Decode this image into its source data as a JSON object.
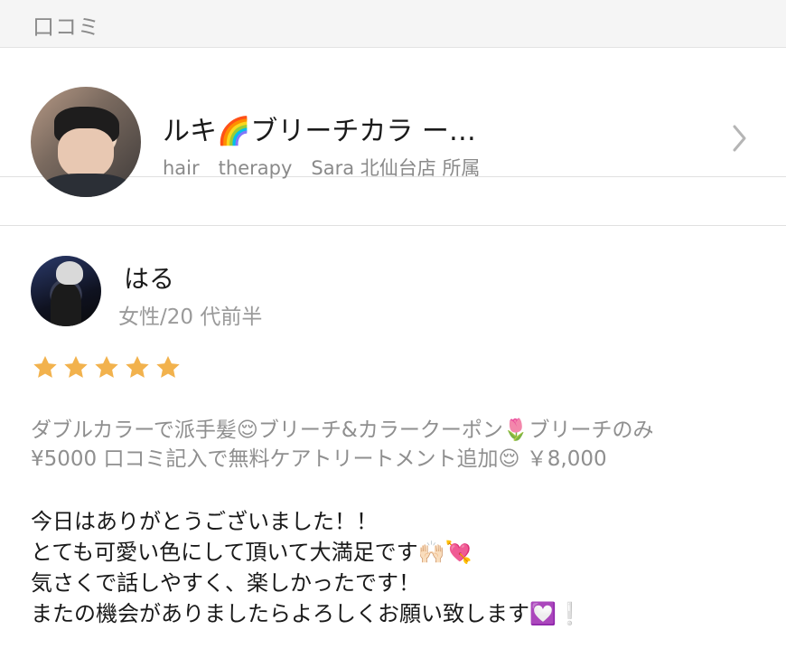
{
  "section": {
    "title": "口コミ"
  },
  "stylist": {
    "name": "ルキ🌈ブリーチカラ ー…",
    "salon": "hair　therapy　Sara 北仙台店 所属"
  },
  "reviewer": {
    "name": "はる",
    "meta": "女性/20 代前半"
  },
  "rating": {
    "stars": 5,
    "star_color": "#f2b24d"
  },
  "coupon": {
    "line1": "ダブルカラーで派手髪😌ブリーチ&カラークーポン🌷ブリーチのみ",
    "line2": "¥5000  口コミ記入で無料ケアトリートメント追加😌 ￥8,000"
  },
  "review": {
    "line1": "今日はありがとうございました！！",
    "line2": "とても可愛い色にして頂いて大満足です🙌🏻💘",
    "line3": "気さくで話しやすく、楽しかったです！",
    "line4": "またの機会がありましたらよろしくお願い致します💟❕"
  },
  "colors": {
    "header_bg": "#f5f5f5",
    "muted_text": "#8a8a8a",
    "divider": "#e0e0e0"
  }
}
